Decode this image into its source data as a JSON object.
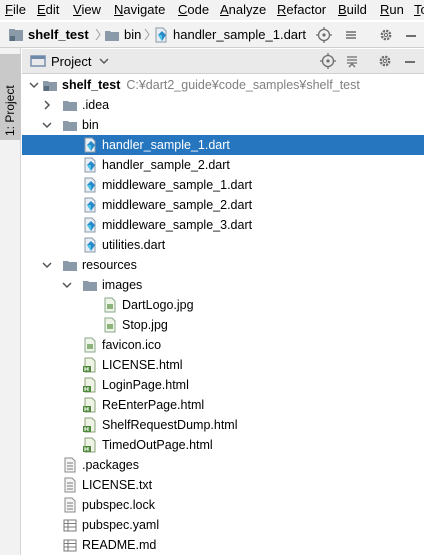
{
  "menu": [
    "File",
    "Edit",
    "View",
    "Navigate",
    "Code",
    "Analyze",
    "Refactor",
    "Build",
    "Run",
    "Tools"
  ],
  "breadcrumb": [
    "shelf_test",
    "bin",
    "handler_sample_1.dart"
  ],
  "toolwindow": {
    "tab_label": "1: Project"
  },
  "panel": {
    "selector_label": "Project"
  },
  "tree": {
    "root": {
      "name": "shelf_test",
      "path": "C:¥dart2_guide¥code_samples¥shelf_test"
    },
    "items": [
      {
        "name": ".idea",
        "kind": "folder",
        "expanded": false
      },
      {
        "name": "bin",
        "kind": "folder",
        "expanded": true
      },
      {
        "name": "handler_sample_1.dart",
        "kind": "dart",
        "selected": true
      },
      {
        "name": "handler_sample_2.dart",
        "kind": "dart"
      },
      {
        "name": "middleware_sample_1.dart",
        "kind": "dart"
      },
      {
        "name": "middleware_sample_2.dart",
        "kind": "dart"
      },
      {
        "name": "middleware_sample_3.dart",
        "kind": "dart"
      },
      {
        "name": "utilities.dart",
        "kind": "dart"
      },
      {
        "name": "resources",
        "kind": "folder",
        "expanded": true
      },
      {
        "name": "images",
        "kind": "folder",
        "expanded": true
      },
      {
        "name": "DartLogo.jpg",
        "kind": "image"
      },
      {
        "name": "Stop.jpg",
        "kind": "image"
      },
      {
        "name": "favicon.ico",
        "kind": "image"
      },
      {
        "name": "LICENSE.html",
        "kind": "html"
      },
      {
        "name": "LoginPage.html",
        "kind": "html"
      },
      {
        "name": "ReEnterPage.html",
        "kind": "html"
      },
      {
        "name": "ShelfRequestDump.html",
        "kind": "html"
      },
      {
        "name": "TimedOutPage.html",
        "kind": "html"
      },
      {
        "name": ".packages",
        "kind": "text"
      },
      {
        "name": "LICENSE.txt",
        "kind": "text"
      },
      {
        "name": "pubspec.lock",
        "kind": "text"
      },
      {
        "name": "pubspec.yaml",
        "kind": "yaml"
      },
      {
        "name": "README.md",
        "kind": "markdown"
      }
    ]
  }
}
